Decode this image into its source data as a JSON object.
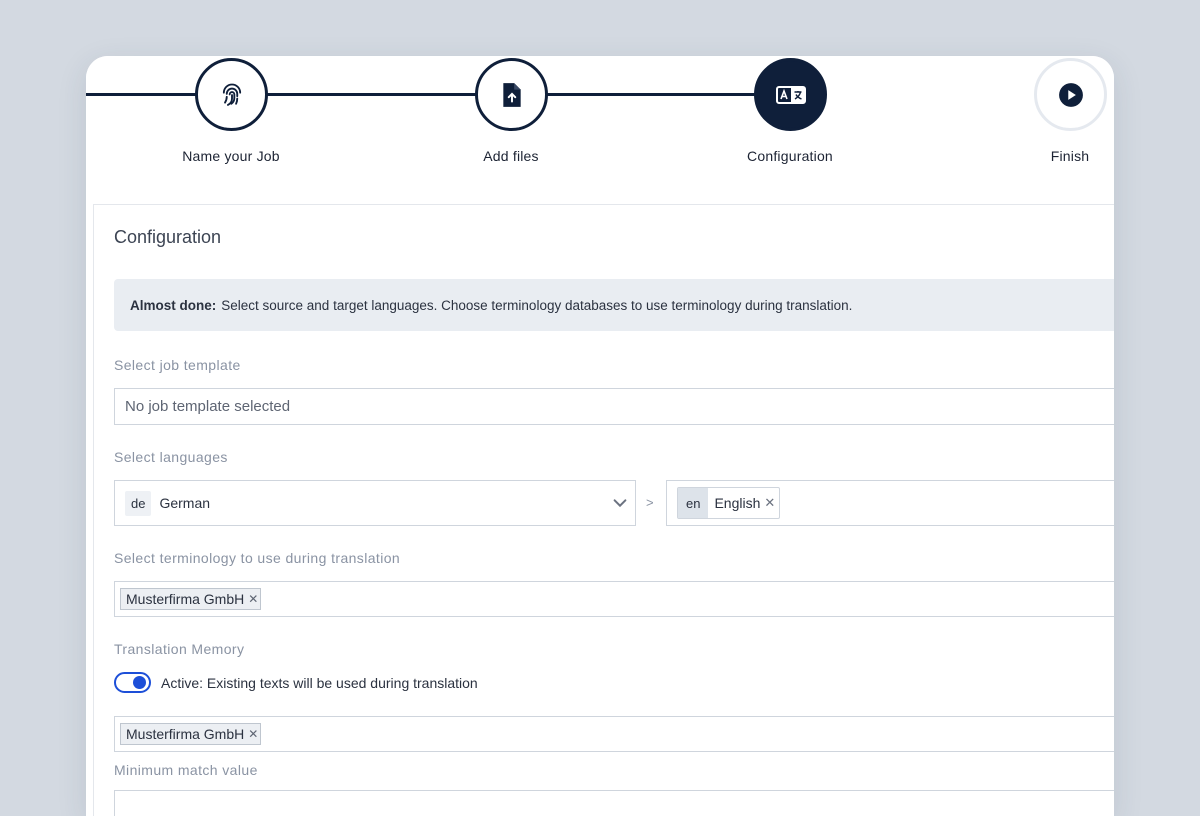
{
  "steps": [
    {
      "label": "Name your Job",
      "icon": "fingerprint-icon",
      "state": "done"
    },
    {
      "label": "Add files",
      "icon": "file-upload-icon",
      "state": "done"
    },
    {
      "label": "Configuration",
      "icon": "translate-icon",
      "state": "active"
    },
    {
      "label": "Finish",
      "icon": "play-icon",
      "state": "upcoming"
    }
  ],
  "panel": {
    "title": "Configuration",
    "info": {
      "strong": "Almost done:",
      "text": "Select source and target languages. Choose terminology databases to use terminology during translation."
    }
  },
  "job_template": {
    "label": "Select job template",
    "value": "No job template selected"
  },
  "languages": {
    "label": "Select languages",
    "source_code": "de",
    "source_name": "German",
    "separator": ">",
    "target_code": "en",
    "target_name": "English"
  },
  "terminology": {
    "label": "Select terminology to use during translation",
    "chip": "Musterfirma GmbH"
  },
  "translation_memory": {
    "label": "Translation Memory",
    "toggle_on": true,
    "toggle_label": "Active: Existing texts will be used during translation",
    "chip": "Musterfirma GmbH"
  },
  "min_match": {
    "label": "Minimum match value"
  },
  "colors": {
    "navy": "#0f1f3a",
    "accent": "#1d4fd8",
    "info_bg": "#e9edf2"
  }
}
